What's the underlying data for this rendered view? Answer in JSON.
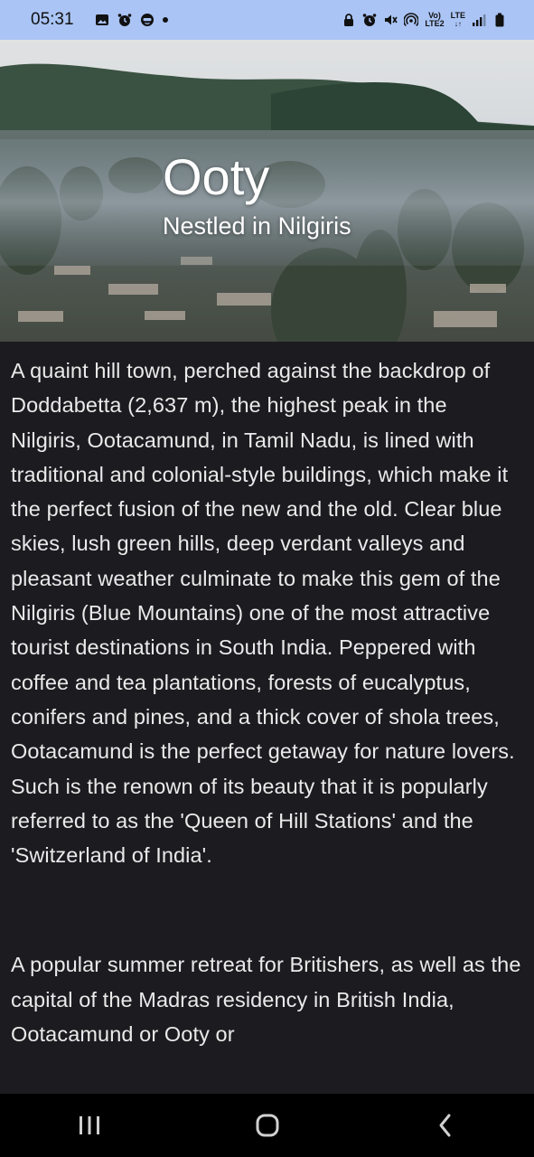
{
  "status_bar": {
    "time": "05:31",
    "left_icons": [
      "gallery-icon",
      "alarm-icon",
      "face-icon"
    ],
    "right_icons": [
      "lock-icon",
      "alarm-icon",
      "mute-icon",
      "hotspot-icon",
      "volte-icon",
      "lte-icon",
      "signal-icon",
      "battery-icon"
    ],
    "volte_label_top": "Vo)",
    "volte_label_bottom": "LTE2",
    "lte_label": "LTE"
  },
  "hero": {
    "title": "Ooty",
    "subtitle": "Nestled in Nilgiris"
  },
  "content": {
    "paragraphs": [
      "A quaint hill town, perched against the backdrop of Doddabetta (2,637 m), the highest peak in the Nilgiris, Ootacamund, in Tamil Nadu, is lined with traditional and colonial-style buildings, which make it the perfect fusion of the new and the old. Clear blue skies, lush green hills, deep verdant valleys and pleasant weather culminate to make this gem of the Nilgiris (Blue Mountains) one of the most attractive tourist destinations in South India. Peppered with coffee and tea plantations, forests of eucalyptus, conifers and pines, and a thick cover of shola trees, Ootacamund is the perfect getaway for nature lovers. Such is the renown of its beauty that it is popularly referred to as the 'Queen of Hill Stations' and the 'Switzerland of India'.",
      "A popular summer retreat for Britishers, as well as the capital of the Madras residency in British India, Ootacamund or Ooty or"
    ]
  },
  "nav_bar": {
    "buttons": [
      "recent-apps-icon",
      "home-icon",
      "back-icon"
    ]
  },
  "colors": {
    "status_bar_bg": "#aac4f5",
    "content_bg": "#1c1b1f",
    "text": "#eaeaea"
  }
}
